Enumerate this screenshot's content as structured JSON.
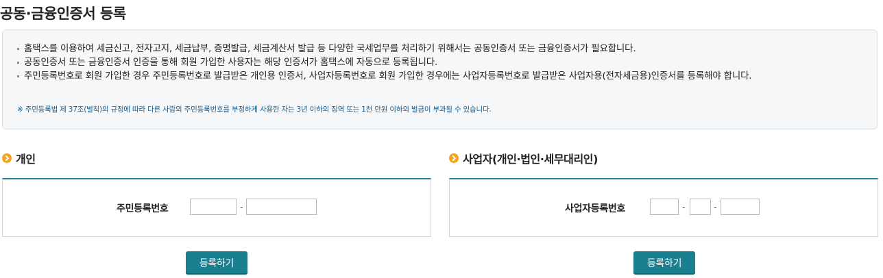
{
  "page": {
    "title": "공동·금융인증서 등록"
  },
  "notice": {
    "items": [
      "홈택스를 이용하여 세금신고, 전자고지, 세금납부, 증명발급, 세금계산서 발급 등 다양한 국세업무를 처리하기 위해서는 공동인증서 또는 금융인증서가 필요합니다.",
      "공동인증서 또는 금융인증서 인증을 통해 회원 가입한 사용자는 해당 인증서가 홈택스에 자동으로 등록됩니다.",
      "주민등록번호로 회원 가입한 경우 주민등록번호로 발급받은 개인용 인증서, 사업자등록번호로 회원 가입한 경우에는 사업자등록번호로 발급받은 사업자용(전자세금용)인증서를 등록해야 합니다."
    ],
    "warning": "※ 주민등록법 제 37조(벌칙)의 규정에 따라 다른 사람의 주민등록번호를 부정하게 사용한 자는 3년 이하의 징역 또는 1천 만원 이하의 벌금이 부과될 수 있습니다."
  },
  "personal": {
    "heading": "개인",
    "field_label": "주민등록번호",
    "dash": "-",
    "rrn_front_value": "",
    "rrn_back_value": "",
    "register_label": "등록하기"
  },
  "business": {
    "heading": "사업자(개인·법인·세무대리인)",
    "field_label": "사업자등록번호",
    "dash": "-",
    "brn_part1_value": "",
    "brn_part2_value": "",
    "brn_part3_value": "",
    "register_label": "등록하기"
  },
  "colors": {
    "accent": "#1f7f99",
    "button": "#1a7f8e",
    "bullet": "#f2a51c",
    "warning_text": "#1e5d8c",
    "notice_bg": "#f5f7f9"
  },
  "icons": {
    "section_bullet": "chevron-circle-icon"
  }
}
